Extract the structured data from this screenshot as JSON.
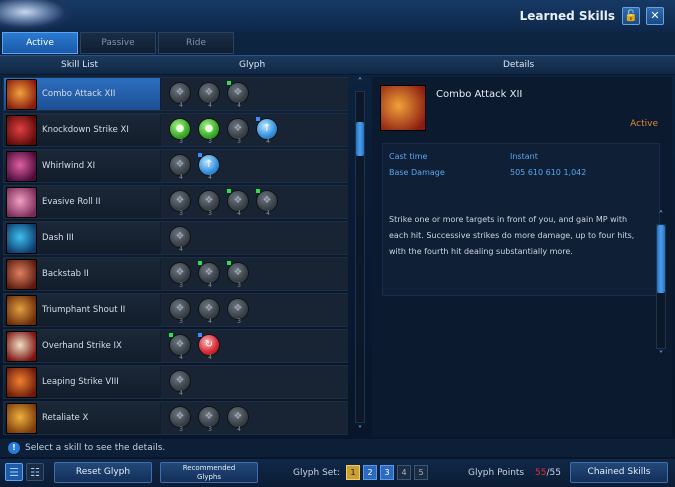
{
  "window": {
    "title": "Learned Skills",
    "lock_icon": "lock-open-icon",
    "close_icon": "close-icon"
  },
  "tabs": [
    {
      "label": "Active",
      "active": true
    },
    {
      "label": "Passive",
      "active": false
    },
    {
      "label": "Ride",
      "active": false
    }
  ],
  "columns": {
    "skill_list": "Skill List",
    "glyph": "Glyph",
    "details": "Details"
  },
  "skills": [
    {
      "name": "Combo Attack XII",
      "selected": true,
      "icon_colors": [
        "#f0a23a",
        "#8a1a10"
      ],
      "glyphs": [
        {
          "style": "grey",
          "flag": "",
          "count": "4"
        },
        {
          "style": "grey",
          "flag": "",
          "count": "4"
        },
        {
          "style": "grey",
          "flag": "green",
          "count": "4"
        }
      ]
    },
    {
      "name": "Knockdown Strike XI",
      "selected": false,
      "icon_colors": [
        "#e04040",
        "#5a0a0a"
      ],
      "glyphs": [
        {
          "style": "green",
          "flag": "",
          "count": "3"
        },
        {
          "style": "green",
          "flag": "",
          "count": "3"
        },
        {
          "style": "grey",
          "flag": "",
          "count": "3"
        },
        {
          "style": "blue",
          "flag": "blue",
          "count": "4"
        }
      ]
    },
    {
      "name": "Whirlwind XI",
      "selected": false,
      "icon_colors": [
        "#e060a0",
        "#4a0a3a"
      ],
      "glyphs": [
        {
          "style": "grey",
          "flag": "",
          "count": "4"
        },
        {
          "style": "blue",
          "flag": "blue",
          "count": "4"
        }
      ]
    },
    {
      "name": "Evasive Roll II",
      "selected": false,
      "icon_colors": [
        "#f0a0c0",
        "#7a2a5a"
      ],
      "glyphs": [
        {
          "style": "grey",
          "flag": "",
          "count": "3"
        },
        {
          "style": "grey",
          "flag": "",
          "count": "3"
        },
        {
          "style": "grey",
          "flag": "green",
          "count": "4"
        },
        {
          "style": "grey",
          "flag": "green",
          "count": "4"
        }
      ]
    },
    {
      "name": "Dash III",
      "selected": false,
      "icon_colors": [
        "#40c0f0",
        "#0a3a6a"
      ],
      "glyphs": [
        {
          "style": "grey",
          "flag": "",
          "count": "4"
        }
      ]
    },
    {
      "name": "Backstab II",
      "selected": false,
      "icon_colors": [
        "#e08060",
        "#5a1a10"
      ],
      "glyphs": [
        {
          "style": "grey",
          "flag": "",
          "count": "3"
        },
        {
          "style": "grey",
          "flag": "green",
          "count": "4"
        },
        {
          "style": "grey",
          "flag": "green",
          "count": "3"
        }
      ]
    },
    {
      "name": "Triumphant Shout II",
      "selected": false,
      "icon_colors": [
        "#e0a040",
        "#6a2a0a"
      ],
      "glyphs": [
        {
          "style": "grey",
          "flag": "",
          "count": "3"
        },
        {
          "style": "grey",
          "flag": "",
          "count": "4"
        },
        {
          "style": "grey",
          "flag": "",
          "count": "3"
        }
      ]
    },
    {
      "name": "Overhand Strike IX",
      "selected": false,
      "icon_colors": [
        "#f0e0c0",
        "#7a1010"
      ],
      "glyphs": [
        {
          "style": "grey",
          "flag": "green",
          "count": "4"
        },
        {
          "style": "red",
          "flag": "blue",
          "count": "4"
        }
      ]
    },
    {
      "name": "Leaping Strike VIII",
      "selected": false,
      "icon_colors": [
        "#f08030",
        "#6a1a0a"
      ],
      "glyphs": [
        {
          "style": "grey",
          "flag": "",
          "count": "4"
        }
      ]
    },
    {
      "name": "Retaliate X",
      "selected": false,
      "icon_colors": [
        "#f0b040",
        "#7a3a0a"
      ],
      "glyphs": [
        {
          "style": "grey",
          "flag": "",
          "count": "3"
        },
        {
          "style": "grey",
          "flag": "",
          "count": "3"
        },
        {
          "style": "grey",
          "flag": "",
          "count": "4"
        }
      ]
    }
  ],
  "details": {
    "name": "Combo Attack XII",
    "type": "Active",
    "cast_time_label": "Cast time",
    "cast_time_value": "Instant",
    "base_damage_label": "Base Damage",
    "base_damage_value": "505 610 610 1,042",
    "description": "Strike one or more targets in front of you, and gain MP with each hit. Successive strikes do more damage, up to four hits, with the fourth hit dealing substantially more."
  },
  "status": {
    "text": "Select a skill to see the details.",
    "icon": "info-icon"
  },
  "footer": {
    "list_view_icon": "list-view-icon",
    "grid_view_icon": "grid-view-icon",
    "reset_glyph": "Reset Glyph",
    "recommended_line1": "Recommended",
    "recommended_line2": "Glyphs",
    "glyph_set_label": "Glyph Set:",
    "glyph_sets": [
      {
        "label": "1",
        "state": "active"
      },
      {
        "label": "2",
        "state": "blue"
      },
      {
        "label": "3",
        "state": "blue"
      },
      {
        "label": "4",
        "state": "inactive"
      },
      {
        "label": "5",
        "state": "inactive"
      }
    ],
    "glyph_points_label": "Glyph Points",
    "glyph_points_current": "55",
    "glyph_points_max": "/55",
    "chained_skills": "Chained Skills"
  },
  "list_scroll_fraction": 0.1,
  "details_scroll_fraction": 0.0
}
